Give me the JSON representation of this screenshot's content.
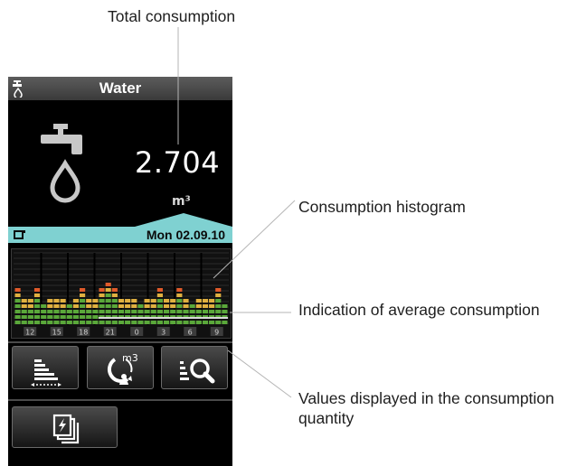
{
  "callouts": {
    "total": "Total consumption",
    "histogram": "Consumption histogram",
    "average": "Indication of average consumption",
    "values_line1": "Values displayed in the consumption",
    "values_line2": "quantity"
  },
  "device": {
    "title": "Water",
    "title_icon": "water-tap-icon",
    "main_icon": "faucet-drop-icon",
    "total_value": "2.704",
    "unit": "m³",
    "date_icon": "period-selector-icon",
    "date": "Mon 02.09.10",
    "buttons": [
      {
        "name": "histogram-view-button",
        "icon": "histogram-bars-icon"
      },
      {
        "name": "consumption-quantity-button",
        "icon": "m3-cycle-icon"
      },
      {
        "name": "zoom-button",
        "icon": "list-magnifier-icon"
      },
      {
        "name": "multi-page-button",
        "icon": "pages-lightning-icon"
      }
    ],
    "button_icon_text": "m3"
  },
  "colors": {
    "background": "#000000",
    "titlebar": "#4a4a4a",
    "datebar": "#7fd1d1",
    "histogram_low": "#5aa83a",
    "histogram_high": "#e0b040",
    "histogram_peak": "#e05a2a",
    "average_line": "#d8d8d8"
  },
  "chart_data": {
    "type": "bar",
    "categories": [
      "12",
      "15",
      "18",
      "21",
      "0",
      "3",
      "6",
      "9"
    ],
    "series": [
      {
        "values": [
          5,
          4,
          4,
          5,
          3,
          4,
          4,
          4,
          3,
          4,
          5,
          4,
          4,
          5,
          6,
          5,
          4,
          4,
          4,
          3,
          4,
          4,
          5,
          4,
          4,
          5,
          4,
          3,
          4,
          4,
          4,
          5,
          3
        ]
      }
    ],
    "ylim": [
      0,
      10
    ],
    "grid": true
  }
}
